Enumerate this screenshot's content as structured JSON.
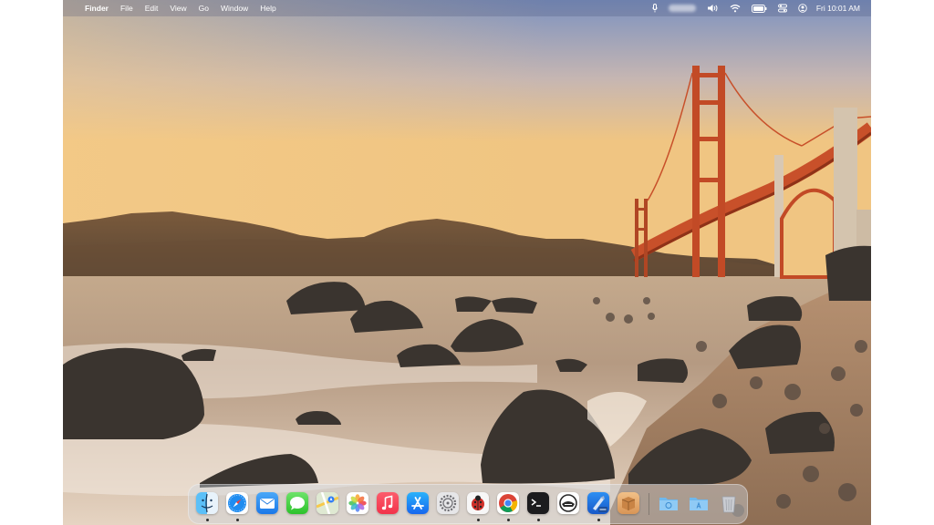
{
  "menubar": {
    "apple": "",
    "app_name": "Finder",
    "menus": [
      "File",
      "Edit",
      "View",
      "Go",
      "Window",
      "Help"
    ],
    "clock": "Fri 10:01 AM",
    "status_icons": [
      "microphone-icon",
      "blurred-status-item",
      "volume-icon",
      "wifi-icon",
      "battery-icon",
      "control-center-icon",
      "user-switch-icon"
    ]
  },
  "wallpaper": {
    "subject": "golden-gate-bridge-beach",
    "sky_top": "#7890be",
    "sky_horizon": "#f0c07c",
    "bridge_color": "#c8502a"
  },
  "dock": {
    "apps": [
      {
        "name": "Finder",
        "icon": "finder-icon",
        "running": true
      },
      {
        "name": "Safari",
        "icon": "safari-icon",
        "running": true
      },
      {
        "name": "Mail",
        "icon": "mail-icon",
        "running": false
      },
      {
        "name": "Messages",
        "icon": "messages-icon",
        "running": false
      },
      {
        "name": "Maps",
        "icon": "maps-icon",
        "running": false
      },
      {
        "name": "Photos",
        "icon": "photos-icon",
        "running": false
      },
      {
        "name": "Music",
        "icon": "music-icon",
        "running": false
      },
      {
        "name": "App Store",
        "icon": "app-store-icon",
        "running": false
      },
      {
        "name": "System Settings",
        "icon": "settings-icon",
        "running": false
      },
      {
        "name": "Bug App",
        "icon": "ladybug-icon",
        "running": true
      },
      {
        "name": "Chrome",
        "icon": "chrome-icon",
        "running": true
      },
      {
        "name": "Terminal",
        "icon": "terminal-icon",
        "running": true
      },
      {
        "name": "Helmet App",
        "icon": "helmet-icon",
        "running": false
      },
      {
        "name": "Xcode Beta",
        "icon": "xcode-beta-icon",
        "running": true
      },
      {
        "name": "Package",
        "icon": "package-icon",
        "running": false
      }
    ],
    "stacks": [
      {
        "name": "Downloads",
        "icon": "downloads-folder-icon"
      },
      {
        "name": "Applications",
        "icon": "applications-folder-icon"
      },
      {
        "name": "Trash",
        "icon": "trash-icon"
      }
    ]
  }
}
